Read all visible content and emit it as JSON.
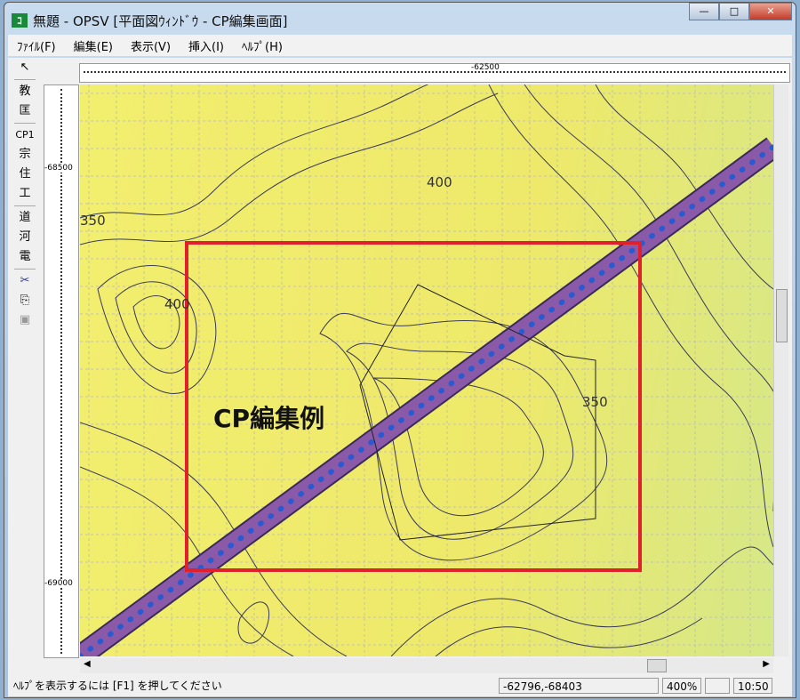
{
  "window": {
    "title": "無題 - OPSV [平面図ｳｨﾝﾄﾞｳ - CP編集画面]",
    "minimize": "—",
    "maximize": "□",
    "close": "✕"
  },
  "menu": [
    "ﾌｧｲﾙ(F)",
    "編集(E)",
    "表示(V)",
    "挿入(I)",
    "ﾍﾙﾌﾟ(H)"
  ],
  "toolbar": {
    "items": [
      "教",
      "匡",
      "CP1",
      "宗",
      "住",
      "工",
      "道",
      "河",
      "電"
    ],
    "icons": [
      "pointer-icon",
      "scissors-icon",
      "copy-icon",
      "paste-icon"
    ]
  },
  "ruler": {
    "top_label": "-62500",
    "left_labels": [
      "-68500",
      "-69000"
    ]
  },
  "map": {
    "contour_labels": [
      "400",
      "350",
      "400",
      "350"
    ],
    "annotation": "CP編集例",
    "colors": {
      "frame": "#e0202a",
      "road": "#8a5aa8",
      "dots": "#2a5ad0"
    }
  },
  "status": {
    "help": "ﾍﾙﾌﾟを表示するには [F1] を押してください",
    "coords": "-62796,-68403",
    "zoom": "400%",
    "empty": "",
    "time": "10:50"
  }
}
